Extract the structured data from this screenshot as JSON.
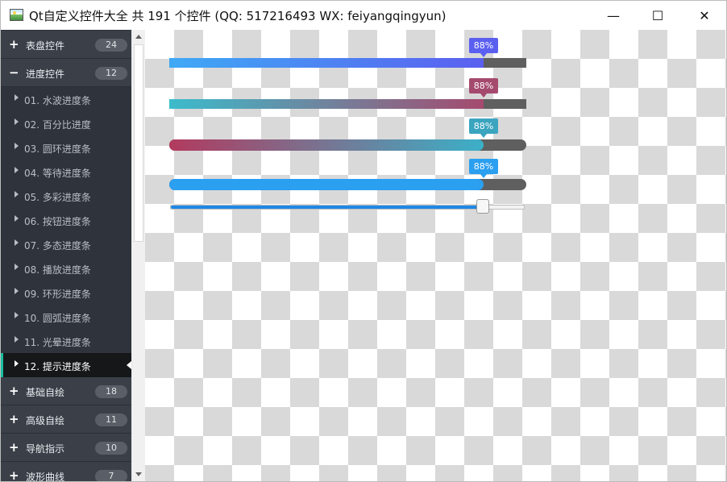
{
  "window": {
    "title": "Qt自定义控件大全 共 191 个控件 (QQ: 517216493 WX: feiyangqingyun)",
    "minimize_glyph": "—",
    "maximize_glyph": "☐",
    "close_glyph": "✕",
    "icon": "picture-icon"
  },
  "nav": {
    "groups": [
      {
        "sign": "+",
        "label": "表盘控件",
        "count": "24"
      },
      {
        "sign": "−",
        "label": "进度控件",
        "count": "12"
      },
      {
        "sign": "+",
        "label": "基础自绘",
        "count": "18"
      },
      {
        "sign": "+",
        "label": "高级自绘",
        "count": "11"
      },
      {
        "sign": "+",
        "label": "导航指示",
        "count": "10"
      },
      {
        "sign": "+",
        "label": "波形曲线",
        "count": "7"
      }
    ],
    "items": [
      {
        "label": "01. 水波进度条"
      },
      {
        "label": "02. 百分比进度"
      },
      {
        "label": "03. 圆环进度条"
      },
      {
        "label": "04. 等待进度条"
      },
      {
        "label": "05. 多彩进度条"
      },
      {
        "label": "06. 按钮进度条"
      },
      {
        "label": "07. 多态进度条"
      },
      {
        "label": "08. 播放进度条"
      },
      {
        "label": "09. 环形进度条"
      },
      {
        "label": "10. 圆弧进度条"
      },
      {
        "label": "11. 光晕进度条"
      },
      {
        "label": "12. 提示进度条"
      }
    ],
    "active_index": 11,
    "colors": {
      "background": "#2f333b",
      "group": "#3a3f48",
      "active": "#151719",
      "accent": "#1abc9c"
    }
  },
  "progress": {
    "value_fraction": 0.88,
    "bars": [
      {
        "tip": "88%",
        "style": "square",
        "colors": [
          "#3fa9f5",
          "#5b5ff0"
        ],
        "tip_color": "#5b5ff0"
      },
      {
        "tip": "88%",
        "style": "square",
        "colors": [
          "#3bbccc",
          "#a54a6e"
        ],
        "tip_color": "#a54a6e"
      },
      {
        "tip": "88%",
        "style": "rounded",
        "colors": [
          "#b23a5e",
          "#3bb0c8"
        ],
        "tip_color": "#3ba5c0"
      },
      {
        "tip": "88%",
        "style": "rounded",
        "colors": [
          "#2b9ff0",
          "#2b9ff0"
        ],
        "tip_color": "#2b9ff0"
      }
    ],
    "track_color": "#5f5f5f",
    "slider_fraction": 0.88
  }
}
